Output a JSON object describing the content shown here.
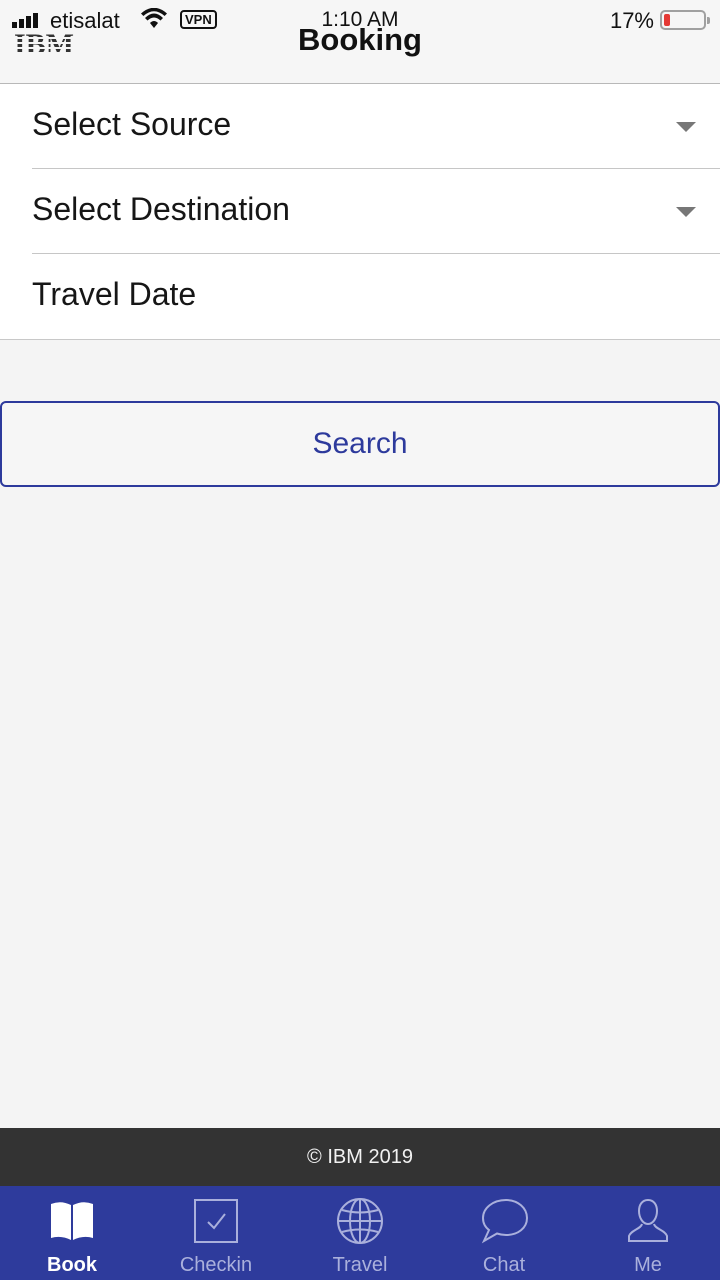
{
  "status_bar": {
    "carrier": "etisalat",
    "vpn": "VPN",
    "time": "1:10 AM",
    "battery_percent": "17%",
    "battery_level": 0.17,
    "battery_color": "#e53935"
  },
  "header": {
    "logo_text": "IBM",
    "title": "Booking"
  },
  "form": {
    "source_label": "Select Source",
    "destination_label": "Select Destination",
    "travel_date_label": "Travel Date"
  },
  "search_button": {
    "label": "Search",
    "color": "#2d3a9c"
  },
  "footer": {
    "text": "© IBM 2019"
  },
  "tabbar": {
    "background": "#2e3b9c",
    "tabs": [
      {
        "label": "Book",
        "icon": "book-icon",
        "active": true
      },
      {
        "label": "Checkin",
        "icon": "checkbox-icon",
        "active": false
      },
      {
        "label": "Travel",
        "icon": "globe-icon",
        "active": false
      },
      {
        "label": "Chat",
        "icon": "chat-bubble-icon",
        "active": false
      },
      {
        "label": "Me",
        "icon": "person-icon",
        "active": false
      }
    ]
  }
}
